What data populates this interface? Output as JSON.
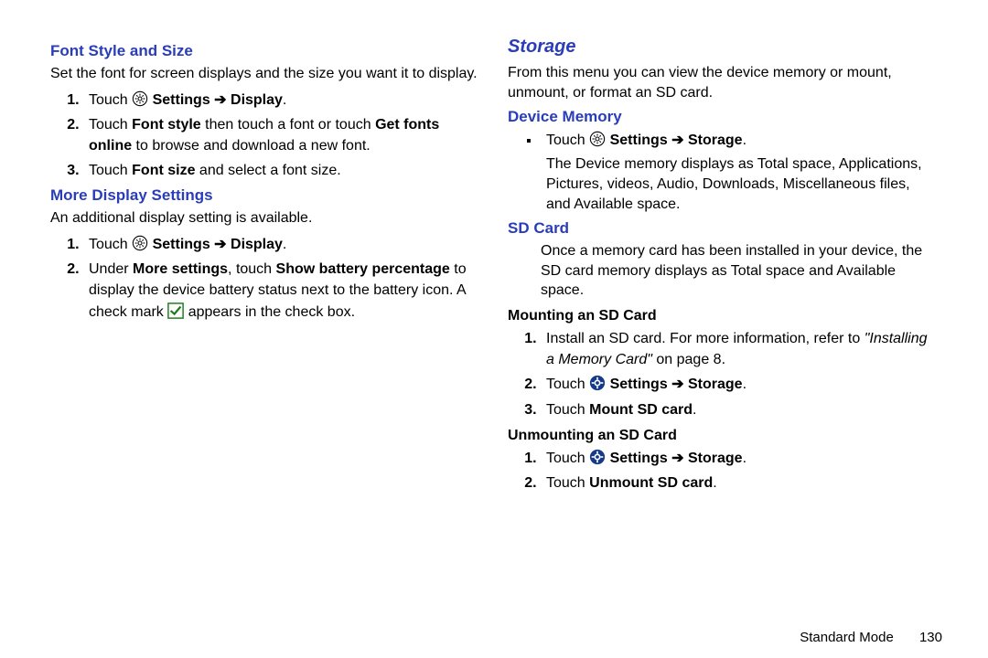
{
  "left": {
    "section1": {
      "title": "Font Style and Size",
      "intro": "Set the font for screen displays and the size you want it to display.",
      "step1_a": "Touch ",
      "step1_b": " Settings ➔ Display",
      "step1_c": ".",
      "step2_a": "Touch ",
      "step2_b": "Font style",
      "step2_c": " then touch a font or touch ",
      "step2_d": "Get fonts online",
      "step2_e": " to browse and download a new font.",
      "step3_a": "Touch ",
      "step3_b": "Font size",
      "step3_c": " and select a font size."
    },
    "section2": {
      "title": "More Display Settings",
      "intro": "An additional display setting is available.",
      "step1_a": "Touch ",
      "step1_b": " Settings ➔ Display",
      "step1_c": ".",
      "step2_a": "Under ",
      "step2_b": "More settings",
      "step2_c": ", touch ",
      "step2_d": "Show battery percentage",
      "step2_e": " to display the device battery status next to the battery icon. A check mark ",
      "step2_f": " appears in the check box."
    }
  },
  "right": {
    "section_title": "Storage",
    "intro": "From this menu you can view the device memory or mount, unmount, or format an SD card.",
    "devmem": {
      "title": "Device Memory",
      "bul_a": "Touch ",
      "bul_b": " Settings ➔ Storage",
      "bul_c": ".",
      "desc": "The Device memory displays as Total space, Applications, Pictures, videos, Audio, Downloads, Miscellaneous files, and Available space."
    },
    "sdcard": {
      "title": "SD Card",
      "desc": "Once a memory card has been installed in your device, the SD card memory displays as Total space and Available space.",
      "mount_title": "Mounting an SD Card",
      "m1_a": "Install an SD card. For more information, refer to ",
      "m1_b": "\"Installing a Memory Card\"",
      "m1_c": " on page 8.",
      "m2_a": "Touch ",
      "m2_b": " Settings ➔ Storage",
      "m2_c": ".",
      "m3_a": "Touch ",
      "m3_b": "Mount SD card",
      "m3_c": ".",
      "unmount_title": "Unmounting an SD Card",
      "u1_a": "Touch ",
      "u1_b": " Settings ➔ Storage",
      "u1_c": ".",
      "u2_a": "Touch ",
      "u2_b": "Unmount SD card",
      "u2_c": "."
    }
  },
  "footer": {
    "mode": "Standard Mode",
    "page": "130"
  }
}
